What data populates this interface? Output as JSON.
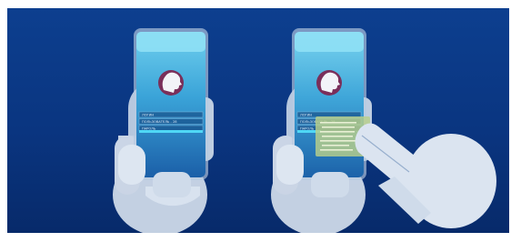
{
  "colors": {
    "background": "#0a3580",
    "screen_top": "#6fd0ee",
    "screen_bottom": "#1b6fb0",
    "hand": "#d8e2ef",
    "avatar_ring": "#7a2f5a",
    "progress": "#4fd7f5",
    "autofill_popup": "#b9cf8a"
  },
  "scenes": [
    {
      "id": "manual-entry",
      "fields": [
        "ЛОГИН",
        "ПОЛЬЗОВАТЕЛЬ - 28",
        "ПАРОЛЬ"
      ],
      "icons": [
        "phone-icon",
        "avatar-icon",
        "hand-icon"
      ]
    },
    {
      "id": "touch-entry",
      "fields": [
        "ЛОГИН",
        "ПОЛЬЗОВАТЕЛЬ - 28",
        "ПАРОЛЬ"
      ],
      "icons": [
        "phone-icon",
        "avatar-icon",
        "hand-icon",
        "pointing-hand-icon"
      ]
    }
  ]
}
